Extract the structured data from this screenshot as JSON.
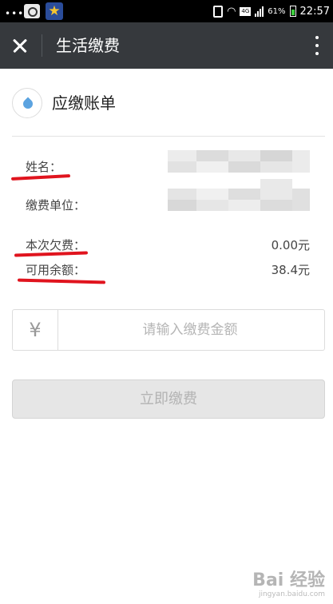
{
  "status_bar": {
    "dots": "•••",
    "network": "4G",
    "battery": "61%",
    "time": "22:57",
    "icons": [
      "camera-app-icon",
      "star-app-icon",
      "phone-icon",
      "wifi-icon",
      "signal-icon",
      "battery-icon"
    ]
  },
  "title_bar": {
    "title": "生活缴费",
    "icons": [
      "close-icon",
      "more-vertical-icon"
    ]
  },
  "bill": {
    "title": "应缴账单",
    "icon": "water-drop-icon",
    "rows": [
      {
        "label": "姓名：",
        "value": ""
      },
      {
        "label": "缴费单位：",
        "value": ""
      },
      {
        "label": "本次欠费：",
        "value": "0.00元"
      },
      {
        "label": "可用余额：",
        "value": "38.4元"
      }
    ]
  },
  "amount": {
    "currency_symbol": "¥",
    "placeholder": "请输入缴费金额",
    "value": ""
  },
  "pay_button": {
    "label": "立即缴费"
  },
  "watermark": {
    "logo": "Bai 经验",
    "url": "jingyan.baidu.com"
  },
  "colors": {
    "titlebar": "#36393d",
    "annotation": "#e0141e",
    "drop": "#5ba3e0",
    "disabled_button": "#e6e6e6"
  }
}
